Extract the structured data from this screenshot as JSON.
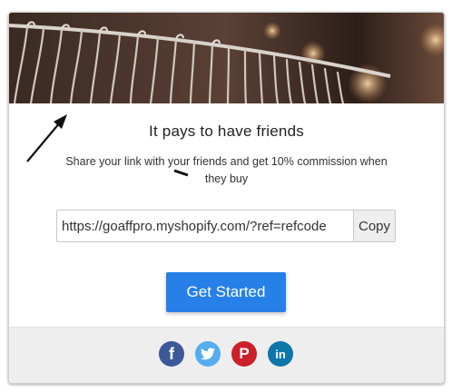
{
  "hero": {
    "image_name": "clothing-rack-hangers-image"
  },
  "content": {
    "title": "It pays to have friends",
    "subtitle": "Share your link with your friends and get 10% commission when they buy",
    "share_link": "https://goaffpro.myshopify.com/?ref=refcode",
    "copy_label": "Copy",
    "cta_label": "Get Started"
  },
  "social": [
    {
      "icon": "facebook-icon",
      "glyph": "f",
      "color": "#3b5998"
    },
    {
      "icon": "twitter-icon",
      "glyph": "",
      "color": "#55acee"
    },
    {
      "icon": "pinterest-icon",
      "glyph": "P",
      "color": "#cb2027"
    },
    {
      "icon": "linkedin-icon",
      "glyph": "in",
      "color": "#0e76a8"
    }
  ],
  "colors": {
    "accent": "#2680e8",
    "footer_bg": "#eeeeee"
  }
}
